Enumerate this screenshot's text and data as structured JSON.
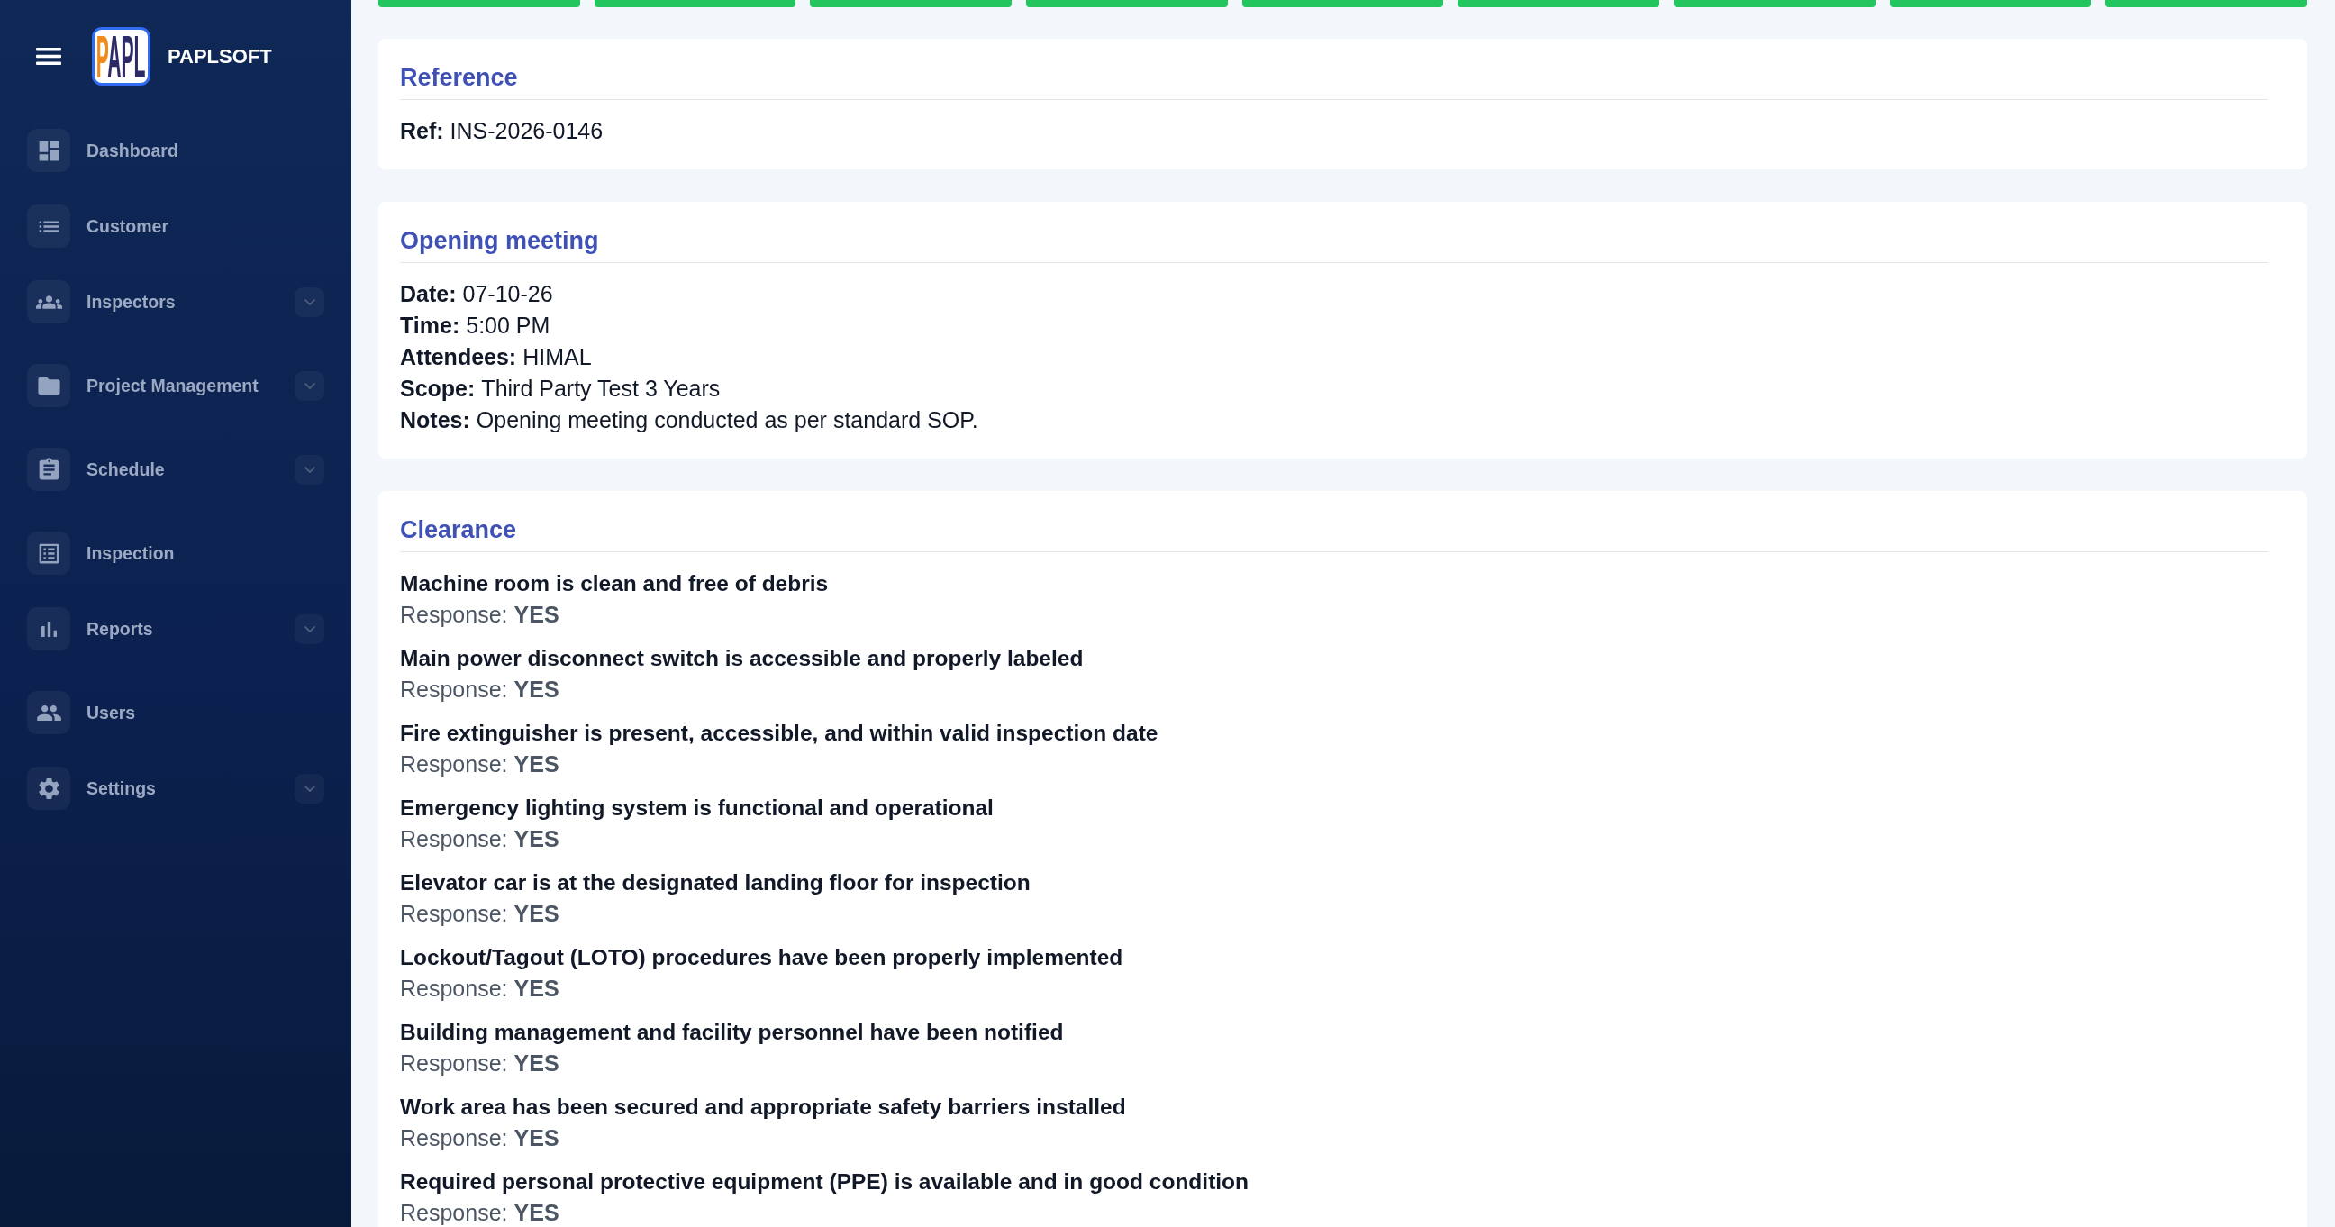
{
  "sidebar": {
    "logo_text": "PAPL",
    "brand": "PAPLSOFT",
    "items": [
      {
        "label": "Dashboard",
        "kind": "link",
        "selected": false
      },
      {
        "label": "Customer",
        "kind": "link",
        "selected": false
      },
      {
        "label": "Inspectors",
        "kind": "group",
        "selected": false,
        "expanded": false
      },
      {
        "label": "Project Management",
        "kind": "group",
        "selected": false,
        "expanded": false
      },
      {
        "label": "Schedule",
        "kind": "group",
        "selected": false,
        "expanded": false
      },
      {
        "label": "Inspection",
        "kind": "link",
        "selected": false
      },
      {
        "label": "Reports",
        "kind": "group",
        "selected": false,
        "expanded": false
      },
      {
        "label": "Users",
        "kind": "link",
        "selected": false
      },
      {
        "label": "Settings",
        "kind": "group",
        "selected": false,
        "expanded": false
      }
    ]
  },
  "progress_steps": [
    {
      "done": true
    },
    {
      "done": true
    },
    {
      "done": true
    },
    {
      "done": true
    },
    {
      "done": true
    },
    {
      "done": true
    },
    {
      "done": true
    },
    {
      "done": true
    },
    {
      "done": true
    }
  ],
  "sections": [
    {
      "kind": "fields",
      "title": "Reference",
      "fields": [
        {
          "label": "Ref:",
          "value": "INS-2026-0146"
        }
      ]
    },
    {
      "kind": "fields",
      "title": "Opening meeting",
      "fields": [
        {
          "label": "Date:",
          "value": "07-10-26"
        },
        {
          "label": "Time:",
          "value": "5:00 PM"
        },
        {
          "label": "Attendees:",
          "value": "HIMAL"
        },
        {
          "label": "Scope:",
          "value": "Third Party Test 3 Years"
        },
        {
          "label": "Notes:",
          "value": "Opening meeting conducted as per standard SOP."
        }
      ]
    },
    {
      "kind": "checklist",
      "title": "Clearance",
      "items": [
        {
          "question": "Machine room is clean and free of debris",
          "response_label": "Response:",
          "response": "YES"
        },
        {
          "question": "Main power disconnect switch is accessible and properly labeled",
          "response_label": "Response:",
          "response": "YES"
        },
        {
          "question": "Fire extinguisher is present, accessible, and within valid inspection date",
          "response_label": "Response:",
          "response": "YES"
        },
        {
          "question": "Emergency lighting system is functional and operational",
          "response_label": "Response:",
          "response": "YES"
        },
        {
          "question": "Elevator car is at the designated landing floor for inspection",
          "response_label": "Response:",
          "response": "YES"
        },
        {
          "question": "Lockout/Tagout (LOTO) procedures have been properly implemented",
          "response_label": "Response:",
          "response": "YES"
        },
        {
          "question": "Building management and facility personnel have been notified",
          "response_label": "Response:",
          "response": "YES"
        },
        {
          "question": "Work area has been secured and appropriate safety barriers installed",
          "response_label": "Response:",
          "response": "YES"
        },
        {
          "question": "Required personal protective equipment (PPE) is available and in good condition",
          "response_label": "Response:",
          "response": "YES"
        }
      ]
    }
  ]
}
